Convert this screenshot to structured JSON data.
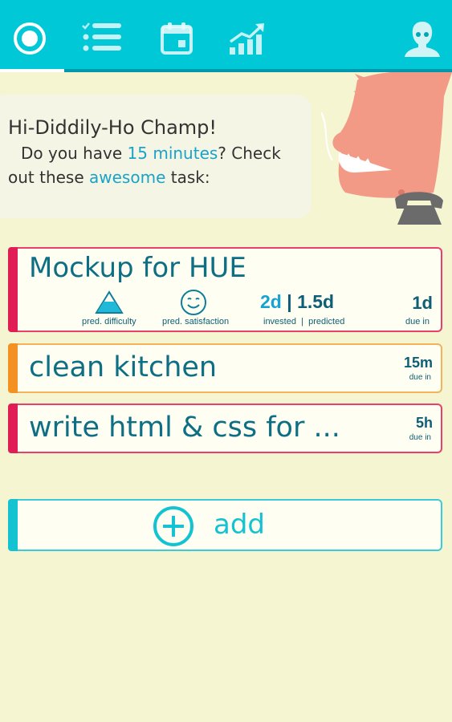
{
  "nav": {
    "items": [
      {
        "icon": "home-circle-icon"
      },
      {
        "icon": "task-list-icon"
      },
      {
        "icon": "calendar-icon"
      },
      {
        "icon": "stats-chart-icon"
      }
    ],
    "profile_icon": "profile-icon",
    "accent": "#00c8d7"
  },
  "greeting": {
    "title": "Hi-Diddily-Ho Champ!",
    "line1_pre": "Do you have ",
    "line1_highlight": "15 minutes",
    "line1_post": "? Check",
    "line2_pre": "out these ",
    "line2_highlight": "awesome",
    "line2_post": " task:"
  },
  "tasks": [
    {
      "title": "Mockup for HUE",
      "difficulty_label": "pred. difficulty",
      "satisfaction_label": "pred. satisfaction",
      "invested": "2d",
      "separator": "|",
      "predicted": "1.5d",
      "invested_label": "invested",
      "predicted_label": "predicted",
      "label_separator": "|",
      "due": "1d",
      "due_label": "due in"
    },
    {
      "title": "clean kitchen",
      "due": "15m",
      "due_label": "due in",
      "color": "#f39223"
    },
    {
      "title": "write html & css for ...",
      "due": "5h",
      "due_label": "due in",
      "color": "#e01e55"
    }
  ],
  "add_button": {
    "label": "add"
  }
}
